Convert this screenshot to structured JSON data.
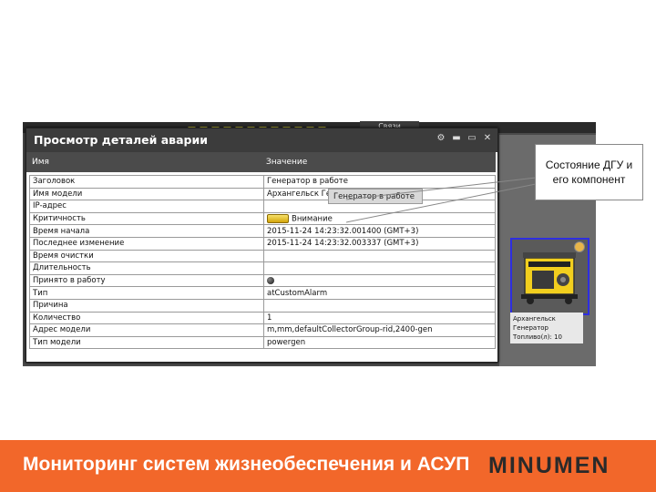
{
  "app": {
    "top_tab_label": "Связи"
  },
  "dialog": {
    "title": "Просмотр деталей аварии",
    "columns": {
      "name": "Имя",
      "value": "Значение"
    },
    "rows": [
      {
        "name": "Заголовок",
        "value": "Генератор в работе"
      },
      {
        "name": "Имя модели",
        "value": "Архангельск Ге"
      },
      {
        "name": "IP-адрес",
        "value": ""
      },
      {
        "name": "Критичность",
        "value": "Внимание"
      },
      {
        "name": "Время начала",
        "value": "2015-11-24 14:23:32.001400 (GMT+3)"
      },
      {
        "name": "Последнее изменение",
        "value": "2015-11-24 14:23:32.003337 (GMT+3)"
      },
      {
        "name": "Время очистки",
        "value": ""
      },
      {
        "name": "Длительность",
        "value": ""
      },
      {
        "name": "Принято в работу",
        "value": ""
      },
      {
        "name": "Тип",
        "value": "atCustomAlarm"
      },
      {
        "name": "Причина",
        "value": ""
      },
      {
        "name": "Количество",
        "value": "1"
      },
      {
        "name": "Адрес модели",
        "value": "m,mm,defaultCollectorGroup-rid,2400-gen"
      },
      {
        "name": "Тип модели",
        "value": "powergen"
      }
    ],
    "tooltip": "Генератор в работе",
    "criticality_color": "#e6c21a"
  },
  "callout": {
    "line1": "Состояние ДГУ и",
    "line2": "его компонент"
  },
  "generator": {
    "label_line1": "Архангельск",
    "label_line2": "Генератор",
    "label_line3": "Топливо(л): 10",
    "selection_color": "#2e2ee0"
  },
  "footer": {
    "title": "Мониторинг систем жизнеобеспечения и АСУП",
    "logo": "MINUMEN",
    "background": "#f2672a"
  }
}
